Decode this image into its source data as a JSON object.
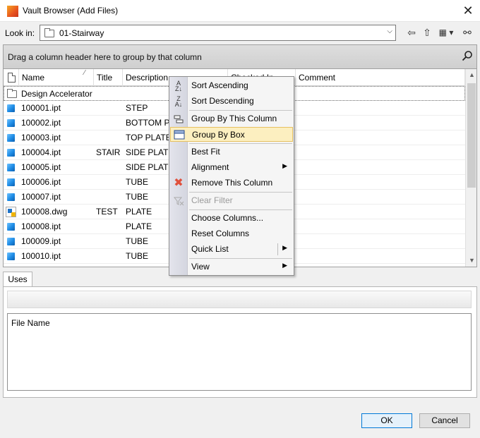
{
  "window": {
    "title": "Vault Browser (Add Files)",
    "close_glyph": "✕"
  },
  "look_in": {
    "label": "Look in:",
    "value": "01-Stairway"
  },
  "toolbar": {
    "back_glyph": "⇦",
    "up_glyph": "⇧",
    "views_glyph": "▦ ▾",
    "find_glyph": "⚯"
  },
  "group_panel": {
    "hint": "Drag a column header here to group by that column"
  },
  "grid": {
    "columns": [
      "Name",
      "Title",
      "Description",
      "Checked In",
      "Comment"
    ],
    "group_label": "Design Accelerator",
    "rows": [
      {
        "name": "100001.ipt",
        "title": "",
        "description": "STEP",
        "type": "ipt"
      },
      {
        "name": "100002.ipt",
        "title": "",
        "description": "BOTTOM PLATE",
        "type": "ipt"
      },
      {
        "name": "100003.ipt",
        "title": "",
        "description": "TOP PLATE",
        "type": "ipt"
      },
      {
        "name": "100004.ipt",
        "title": "STAIR",
        "description": "SIDE PLATE",
        "type": "ipt"
      },
      {
        "name": "100005.ipt",
        "title": "",
        "description": "SIDE PLATE",
        "type": "ipt"
      },
      {
        "name": "100006.ipt",
        "title": "",
        "description": "TUBE",
        "type": "ipt"
      },
      {
        "name": "100007.ipt",
        "title": "",
        "description": "TUBE",
        "type": "ipt"
      },
      {
        "name": "100008.dwg",
        "title": "TEST",
        "description": "PLATE",
        "type": "dwg"
      },
      {
        "name": "100008.ipt",
        "title": "",
        "description": "PLATE",
        "type": "ipt"
      },
      {
        "name": "100009.ipt",
        "title": "",
        "description": "TUBE",
        "type": "ipt"
      },
      {
        "name": "100010.ipt",
        "title": "",
        "description": "TUBE",
        "type": "ipt"
      }
    ]
  },
  "context_menu": {
    "items": [
      {
        "label": "Sort Ascending",
        "icon": "sort-ascending-icon"
      },
      {
        "label": "Sort Descending",
        "icon": "sort-descending-icon"
      },
      {
        "label": "Group By This Column",
        "icon": "group-by-column-icon"
      },
      {
        "label": "Group By Box",
        "icon": "group-by-box-icon",
        "highlighted": true
      },
      {
        "label": "Best Fit"
      },
      {
        "label": "Alignment",
        "submenu": true
      },
      {
        "label": "Remove This Column",
        "icon": "remove-column-icon"
      },
      {
        "label": "Clear Filter",
        "icon": "clear-filter-icon",
        "disabled": true
      },
      {
        "label": "Choose Columns..."
      },
      {
        "label": "Reset Columns"
      },
      {
        "label": "Quick List",
        "submenu": true
      },
      {
        "label": "View",
        "submenu": true
      }
    ]
  },
  "uses": {
    "tab_label": "Uses",
    "list_header": "File Name"
  },
  "buttons": {
    "ok": "OK",
    "cancel": "Cancel"
  },
  "colors": {
    "menu_highlight": "#fcefc0",
    "ok_border": "#0078d7",
    "ipt_icon": "#1e8ce6"
  }
}
